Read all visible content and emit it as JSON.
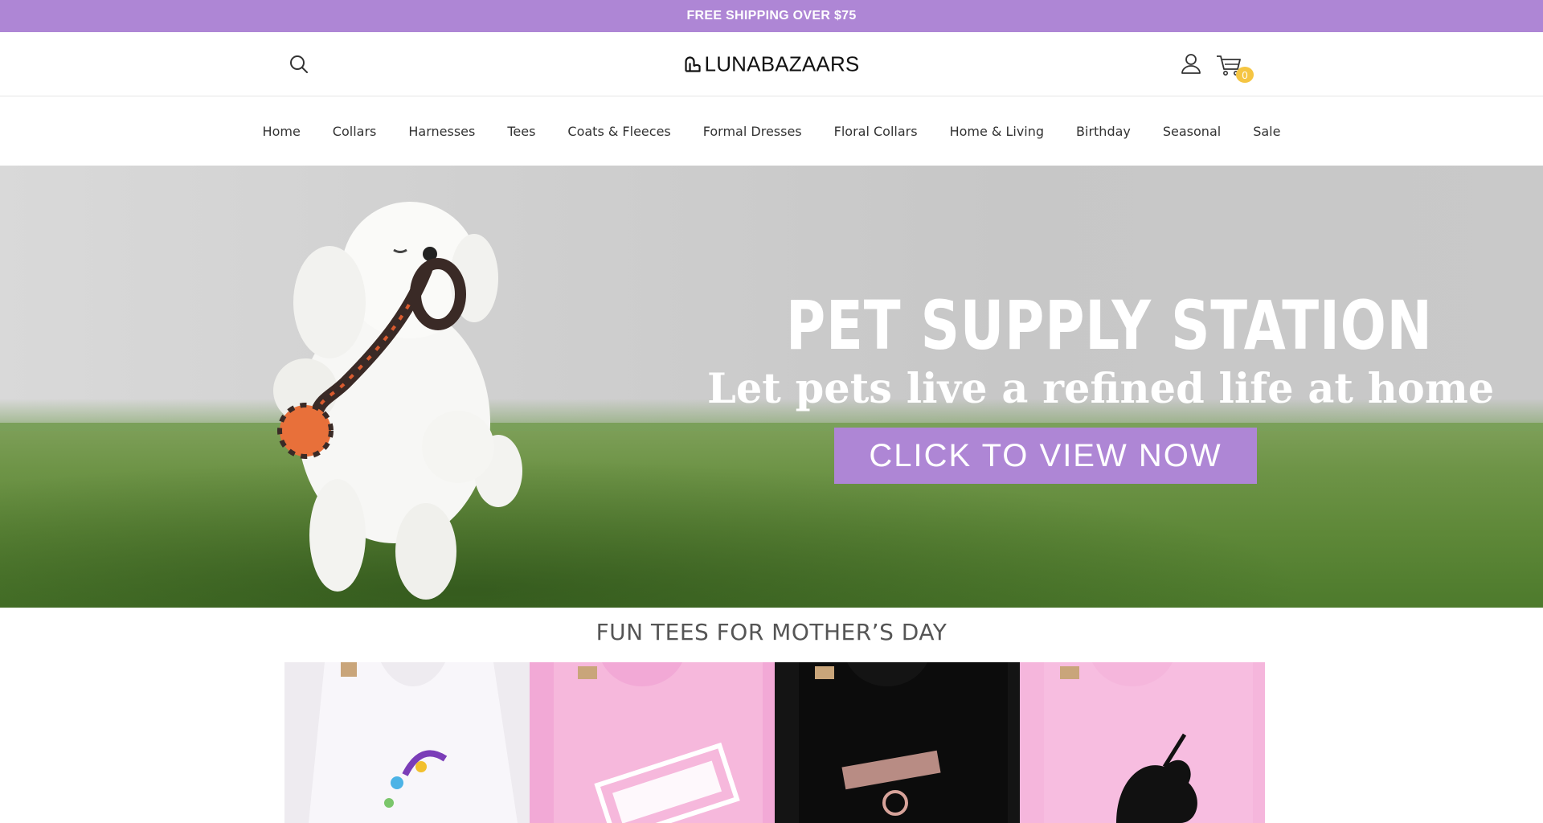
{
  "announcement": "FREE SHIPPING OVER $75",
  "header": {
    "logo_text": "LUNABAZAARS",
    "cart_count": "0"
  },
  "nav": {
    "items": [
      {
        "label": "Home"
      },
      {
        "label": "Collars"
      },
      {
        "label": "Harnesses"
      },
      {
        "label": "Tees"
      },
      {
        "label": "Coats & Fleeces"
      },
      {
        "label": "Formal Dresses"
      },
      {
        "label": "Floral Collars"
      },
      {
        "label": "Home & Living"
      },
      {
        "label": "Birthday"
      },
      {
        "label": "Seasonal"
      },
      {
        "label": "Sale"
      }
    ]
  },
  "hero": {
    "title": "PET SUPPLY STATION",
    "subtitle": "Let pets live a refined life at home",
    "cta": "CLICK TO VIEW NOW"
  },
  "section": {
    "title": "FUN TEES FOR MOTHER’S DAY"
  },
  "products": [
    {
      "image": "white tee with vibes print"
    },
    {
      "image": "pink tee with service print"
    },
    {
      "image": "black tee with daddy's print"
    },
    {
      "image": "pink tee with unicorn print"
    }
  ],
  "colors": {
    "accent": "#ae86d5",
    "badge": "#f5c542"
  }
}
